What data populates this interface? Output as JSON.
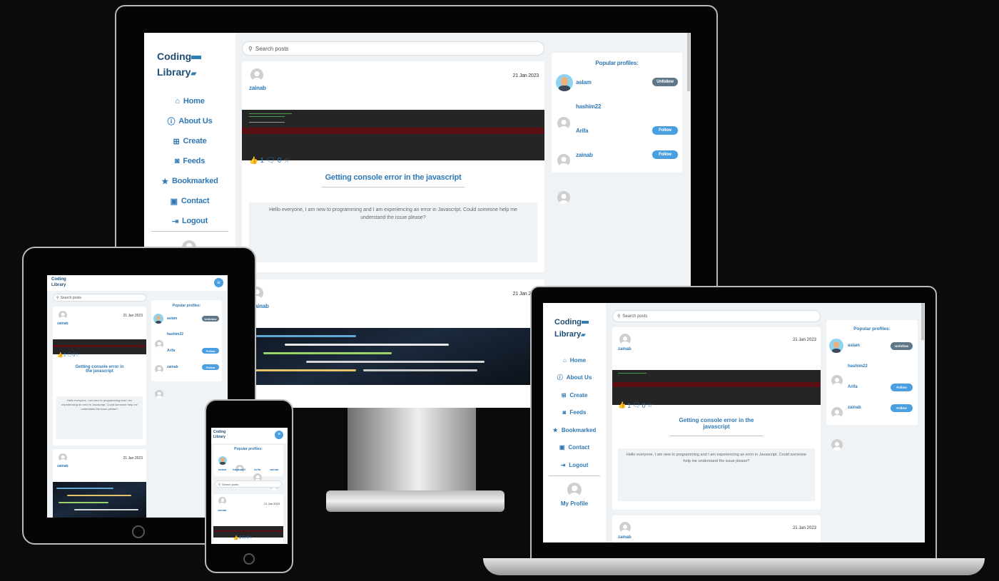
{
  "brand": {
    "line1": "Coding",
    "line2": "Library"
  },
  "nav": [
    {
      "label": "Home",
      "icon": "home-icon"
    },
    {
      "label": "About Us",
      "icon": "info-icon"
    },
    {
      "label": "Create",
      "icon": "plus-square-icon"
    },
    {
      "label": "Feeds",
      "icon": "rss-icon"
    },
    {
      "label": "Bookmarked",
      "icon": "star-icon"
    },
    {
      "label": "Contact",
      "icon": "contact-card-icon"
    },
    {
      "label": "Logout",
      "icon": "logout-icon"
    }
  ],
  "my_profile": "My Profile",
  "search": {
    "placeholder": "Search posts"
  },
  "post": {
    "author": "zainab",
    "date": "21 Jan 2023",
    "likes": "1",
    "comments": "0",
    "title": "Getting console error in the javascript",
    "body": "Hello everyone, I am new to programming and I am experiencing an error in Javascript. Could someone help me understand the issue please?"
  },
  "post2": {
    "author": "zainab",
    "date": "21 Jan 2023"
  },
  "popular": {
    "heading": "Popular profiles:",
    "profiles": [
      {
        "name": "aslam",
        "button": "Unfollow"
      },
      {
        "name": "hashim22",
        "button": ""
      },
      {
        "name": "Arifa",
        "button": "Follow"
      },
      {
        "name": "zainab",
        "button": "Follow"
      }
    ]
  },
  "colors": {
    "accent": "#2e78b5",
    "follow": "#4a9fe0",
    "unfollow": "#5f7787",
    "error_bg": "#5a0f12"
  }
}
